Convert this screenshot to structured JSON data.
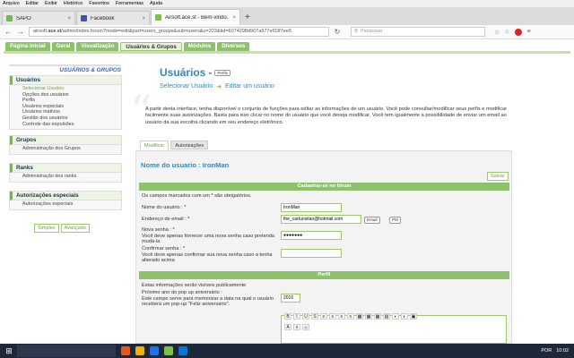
{
  "menu": [
    "Arquivo",
    "Editar",
    "Exibir",
    "Histórico",
    "Favoritos",
    "Ferramentas",
    "Ajuda"
  ],
  "tabs": [
    {
      "label": "SAPO",
      "close": "×"
    },
    {
      "label": "Facebook",
      "close": "×"
    },
    {
      "label": "Airsoft.ace.st - Bem-vindo...",
      "close": "×"
    }
  ],
  "newtab": "+",
  "nav": {
    "back": "←",
    "forward": "→",
    "reload": "↻",
    "home": "⌂",
    "url_prefix": "airsoft.",
    "url_domain": "ace.st",
    "url_rest": "/admin/index.forum?mode=edit&part=users_groups&sub=users&u=223&tid=6074298d907a977ef33f7ee5",
    "search_placeholder": "Pesquisar",
    "star": "☆",
    "menu": "≡"
  },
  "admin_tabs": [
    "Página inicial",
    "Geral",
    "Visualização",
    "Usuários & Grupos",
    "Módulos",
    "Diversos"
  ],
  "sidebar": {
    "heading": "USUÁRIOS & GRUPOS",
    "sections": [
      {
        "title": "Usuários",
        "items": [
          "Selecionar Usuário",
          "Opções dos usuários",
          "Perfis",
          "Usuários especiais",
          "Usuários inativos",
          "Gestão dos usuários",
          "Controle das expulsões"
        ]
      },
      {
        "title": "Grupos",
        "items": [
          "Administração dos Grupos"
        ]
      },
      {
        "title": "Ranks",
        "items": [
          "Administração dos ranks"
        ]
      },
      {
        "title": "Autorizações especiais",
        "items": [
          "Autorizações especiais"
        ]
      }
    ],
    "btn_simple": "Simples",
    "btn_advanced": "Avançado"
  },
  "page": {
    "title": "Usuários",
    "title_sep": "-",
    "profile_btn": "Perfis",
    "step1": "Selecionar Usuário",
    "step_arrow": "➜",
    "step2": "Editar um usuário",
    "description": "A partir desta interface, tenha disponível o conjunto de funções para editar as informações de um usuário. Você pode consultar/modificar seus perfis e modificar facilmente suas autorizações. Basta para isso clicar no nome do usuário que você deseja modificar. Você tem igualmente a possibilidade de enviar um email ao usuário da sua escolha clicando em seu endereço eletrônico.",
    "form_tabs": [
      "Modificar",
      "Autorizações"
    ]
  },
  "form": {
    "user_title": "Nome do usuario : IronMan",
    "save": "Salvar",
    "sec_register": "Cadastrar-se no fórum",
    "required_note": "Os campos marcados com um * são obrigatórios.",
    "username_label": "Nome do usuário : *",
    "username_value": "IronMan",
    "email_label": "Endereço de email : *",
    "email_value": "the_cartunistao@hotmail.com",
    "email_btn": "Email",
    "pm_btn": "PM",
    "pwd_label": "Nova senha : *",
    "pwd_help": "Você deve apenas fornecer uma nova senha caso pretenda mudá-la",
    "pwd_value": "●●●●●●●",
    "confirm_label": "Confirmar senha : *",
    "confirm_help": "Você deve apenas confirmar sua nova senha caso a tenha alterado acima",
    "sec_profile": "Perfil",
    "profile_note": "Estas informações serão visíveis publicamente",
    "birthday_label": "Próximo ano do pop up aniversário :",
    "birthday_help": "Este campo serve para memorizar a data na qual o usuário receberá um pop-up \"Feliz aniversário\".",
    "birthday_value": "2016",
    "rte_tools": [
      "B",
      "I",
      "U",
      "S",
      "≡",
      "≡",
      "≡",
      "≡",
      "▦",
      "▦",
      "▦",
      "▤",
      "◐",
      "◐",
      "▣",
      "A",
      "x",
      "☺"
    ]
  },
  "taskbar": {
    "start": "⊞",
    "lang": "POR",
    "time": "10:02",
    "date": "",
    "app_colors": [
      "#e05a1a",
      "#f0b400",
      "#1a73e8",
      "#7cc242",
      "#0078d7"
    ]
  }
}
